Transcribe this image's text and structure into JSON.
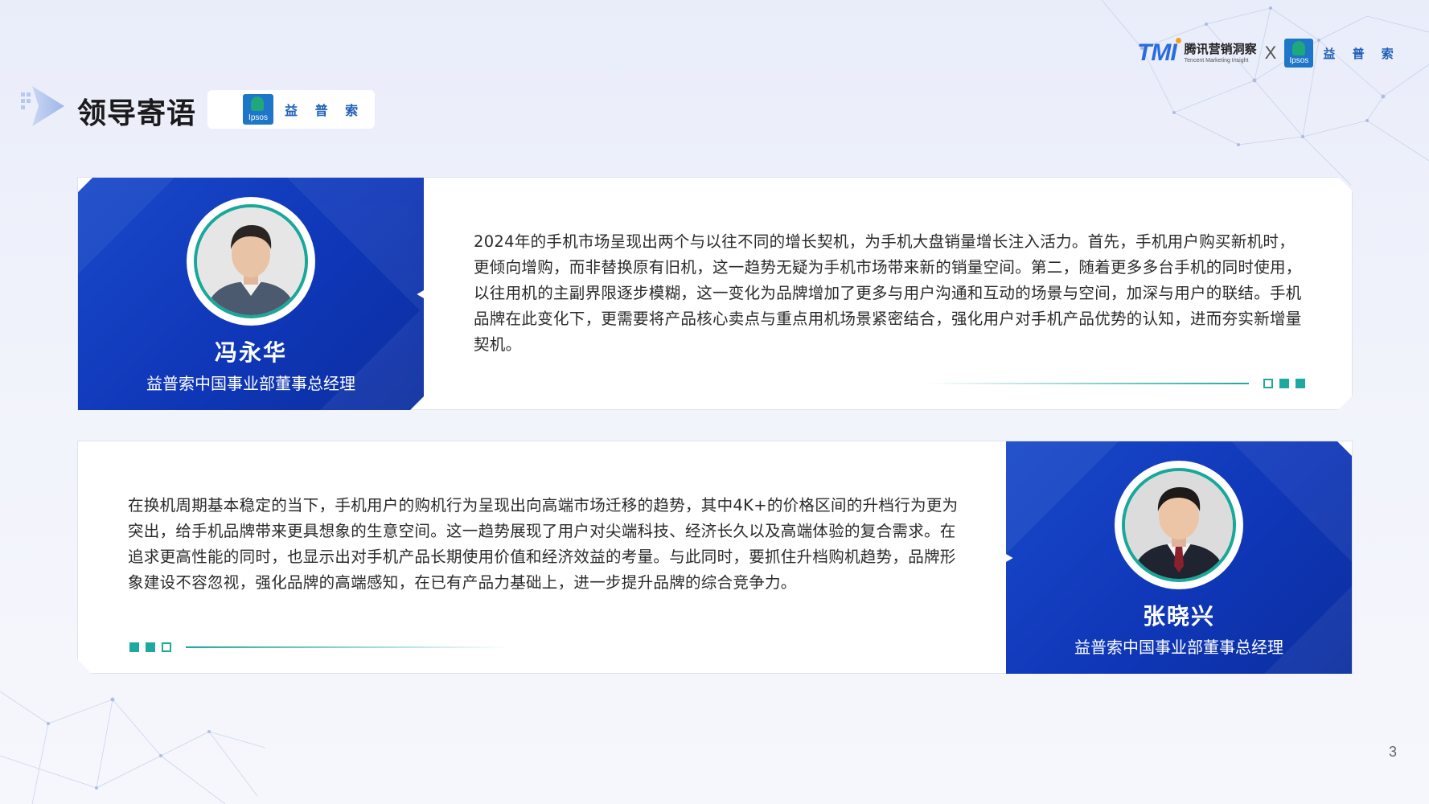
{
  "header": {
    "tmi_logo": "TMI",
    "tmi_cn": "腾讯营销洞察",
    "tmi_en": "Tencent Marketing Insight",
    "times": "X",
    "ipsos_label": "Ipsos",
    "ipsos_cn": "益 普 索"
  },
  "section": {
    "title": "领导寄语",
    "badge_ipsos_label": "Ipsos",
    "badge_cn": "益 普 索"
  },
  "cards": [
    {
      "name": "冯永华",
      "role": "益普索中国事业部董事总经理",
      "quote": "2024年的手机市场呈现出两个与以往不同的增长契机，为手机大盘销量增长注入活力。首先，手机用户购买新机时，更倾向增购，而非替换原有旧机，这一趋势无疑为手机市场带来新的销量空间。第二，随着更多多台手机的同时使用，以往用机的主副界限逐步模糊，这一变化为品牌增加了更多与用户沟通和互动的场景与空间，加深与用户的联结。手机品牌在此变化下，更需要将产品核心卖点与重点用机场景紧密结合，强化用户对手机产品优势的认知，进而夯实新增量契机。"
    },
    {
      "name": "张晓兴",
      "role": "益普索中国事业部董事总经理",
      "quote": "在换机周期基本稳定的当下，手机用户的购机行为呈现出向高端市场迁移的趋势，其中4K+的价格区间的升档行为更为突出，给手机品牌带来更具想象的生意空间。这一趋势展现了用户对尖端科技、经济长久以及高端体验的复合需求。在追求更高性能的同时，也显示出对手机产品长期使用价值和经济效益的考量。与此同时，要抓住升档购机趋势，品牌形象建设不容忽视，强化品牌的高端感知，在已有产品力基础上，进一步提升品牌的综合竞争力。"
    }
  ],
  "page_number": "3",
  "colors": {
    "primary_blue": "#0f37b8",
    "accent_teal": "#1fa8a0",
    "ipsos_blue": "#1e76c8",
    "ipsos_green": "#1fa87a"
  }
}
